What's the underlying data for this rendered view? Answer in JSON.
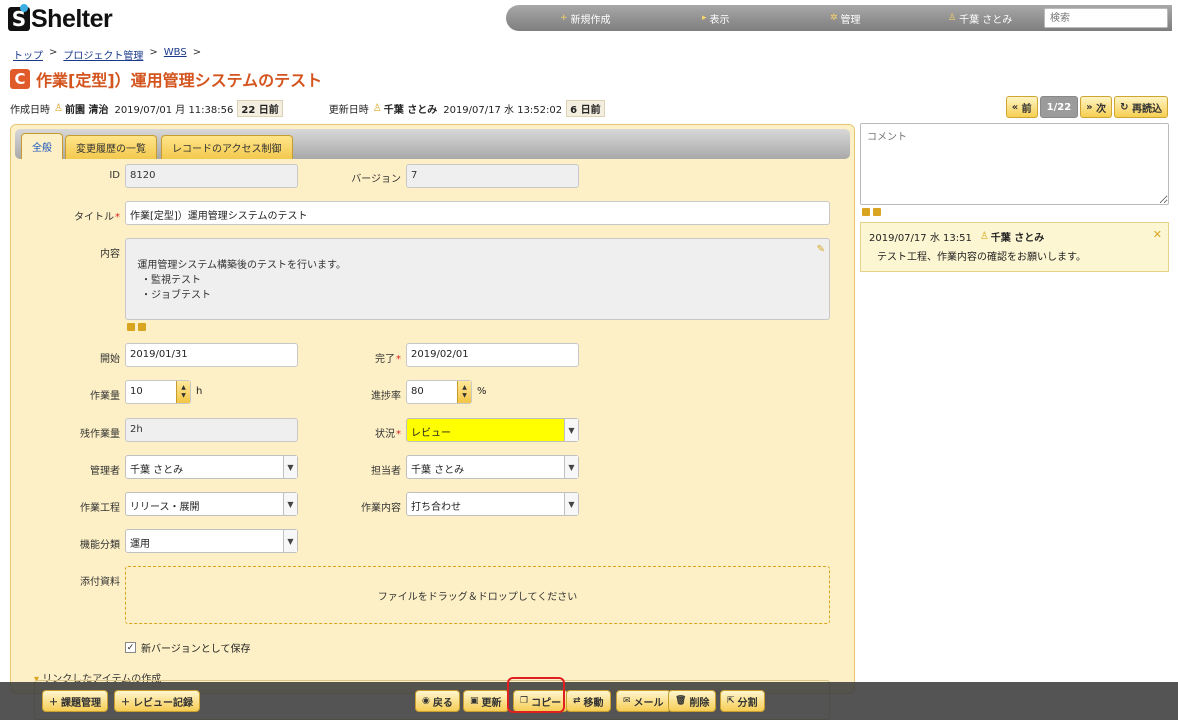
{
  "app": {
    "logo_letter": "S",
    "logo_text": "Shelter"
  },
  "nav": {
    "items": [
      {
        "icon": "+",
        "label": "新規作成"
      },
      {
        "icon": "▸",
        "label": "表示"
      },
      {
        "icon": "✲",
        "label": "管理"
      },
      {
        "icon": "♙",
        "label": "千葉 さとみ"
      }
    ],
    "search_placeholder": "検索"
  },
  "breadcrumb": {
    "items": [
      "トップ",
      "プロジェクト管理",
      "WBS"
    ],
    "sep": ">"
  },
  "page": {
    "title_icon": "C",
    "title": "作業[定型]）運用管理システムのテスト"
  },
  "meta": {
    "created_label": "作成日時",
    "created_user": "前園 清治",
    "created_date": "2019/07/01 月 11:38:56",
    "created_days": "22 日前",
    "updated_label": "更新日時",
    "updated_user": "千葉 さとみ",
    "updated_date": "2019/07/17 水 13:52:02",
    "updated_days": "6 日前"
  },
  "pager": {
    "prev": "前",
    "count": "1/22",
    "next": "次",
    "reload": "再読込"
  },
  "tabs": [
    "全般",
    "変更履歴の一覧",
    "レコードのアクセス制御"
  ],
  "form": {
    "id_label": "ID",
    "id_value": "8120",
    "version_label": "バージョン",
    "version_value": "7",
    "title_label": "タイトル",
    "title_value": "作業[定型]）運用管理システムのテスト",
    "content_label": "内容",
    "content_value": "運用管理システム構築後のテストを行います。\n　・監視テスト\n　・ジョブテスト",
    "start_label": "開始",
    "start_value": "2019/01/31",
    "end_label": "完了",
    "end_value": "2019/02/01",
    "work_label": "作業量",
    "work_value": "10",
    "work_unit": "h",
    "progress_label": "進捗率",
    "progress_value": "80",
    "progress_unit": "%",
    "remaining_label": "残作業量",
    "remaining_value": "2h",
    "status_label": "状況",
    "status_value": "レビュー",
    "manager_label": "管理者",
    "manager_value": "千葉 さとみ",
    "owner_label": "担当者",
    "owner_value": "千葉 さとみ",
    "process_label": "作業工程",
    "process_value": "リリース・展開",
    "work_content_label": "作業内容",
    "work_content_value": "打ち合わせ",
    "function_label": "機能分類",
    "function_value": "運用",
    "attach_label": "添付資料",
    "attach_drop": "ファイルをドラッグ＆ドロップしてください",
    "new_version_label": "新バージョンとして保存",
    "linked_label": "リンクしたアイテムの作成",
    "status_color": "#ffff00"
  },
  "comment": {
    "placeholder": "コメント",
    "date": "2019/07/17 水 13:51",
    "user": "千葉 さとみ",
    "body": "テスト工程、作業内容の確認をお願いします。"
  },
  "toolbar": {
    "back": "戻る",
    "update": "更新",
    "copy": "コピー",
    "move": "移動",
    "mail": "メール",
    "delete": "削除",
    "split": "分割",
    "add_issue": "課題管理",
    "add_review": "レビュー記録"
  }
}
